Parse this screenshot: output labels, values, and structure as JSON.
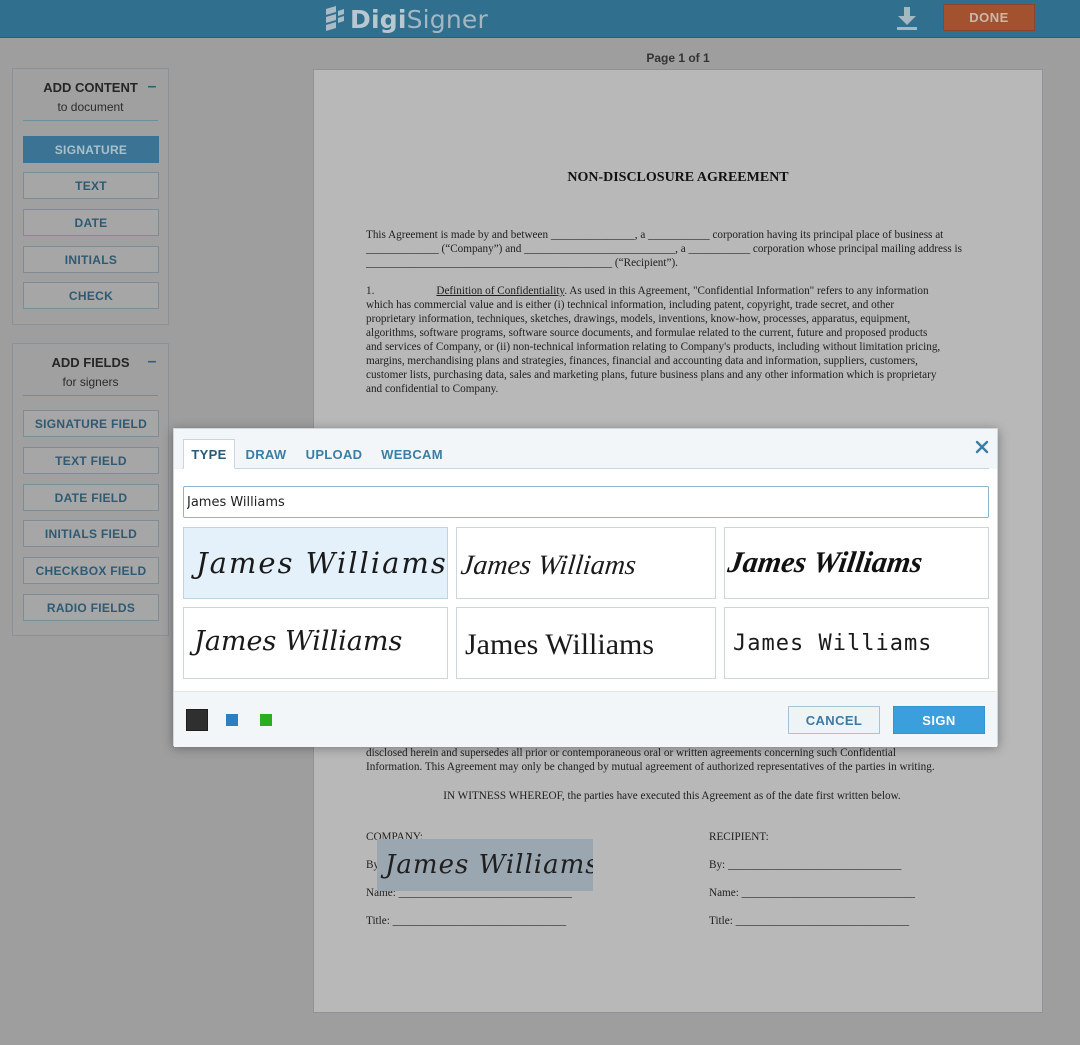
{
  "app": {
    "logo_text_bold": "Digi",
    "logo_text_light": "Signer",
    "download_icon": "download-icon",
    "done_label": "DONE"
  },
  "colors": {
    "topbar": "#316f8e",
    "done": "#a3522f",
    "active_button": "#3a7394",
    "sign_button": "#3a9fdc",
    "ink_black": "#2f2f2f",
    "ink_blue": "#2c7fc0",
    "ink_green": "#2aae1f"
  },
  "panels": {
    "content": {
      "title": "ADD CONTENT",
      "subtitle": "to document",
      "items": [
        {
          "label": "SIGNATURE"
        },
        {
          "label": "TEXT"
        },
        {
          "label": "DATE"
        },
        {
          "label": "INITIALS"
        },
        {
          "label": "CHECK"
        }
      ]
    },
    "fields": {
      "title": "ADD FIELDS",
      "subtitle": "for signers",
      "items": [
        {
          "label": "SIGNATURE FIELD"
        },
        {
          "label": "TEXT FIELD"
        },
        {
          "label": "DATE FIELD"
        },
        {
          "label": "INITIALS FIELD"
        },
        {
          "label": "CHECKBOX FIELD"
        },
        {
          "label": "RADIO FIELDS"
        }
      ]
    }
  },
  "document": {
    "page_label": "Page 1 of 1",
    "title": "NON-DISCLOSURE AGREEMENT",
    "intro": [
      "This Agreement is made by and between _______________, a ___________ corporation having its principal place of business at",
      "_____________ (“Company”) and ___________________________, a ___________ corporation whose principal mailing address is",
      "____________________________________________ (“Recipient”)."
    ],
    "section1_number": "1.",
    "section1_heading": "Definition of Confidentiality",
    "section1_lines": [
      ". As used in this Agreement, \"Confidential Information\" refers to any information",
      "which has commercial value and is either (i) technical information, including patent, copyright, trade secret, and other",
      "proprietary information, techniques, sketches, drawings, models, inventions, know-how, processes, apparatus, equipment,",
      "algorithms, software programs, software source documents, and formulae related to the current, future and proposed products",
      "and services of Company, or (ii) non-technical information relating to Company's products, including without limitation pricing,",
      "margins, merchandising plans and strategies, finances, financial and accounting data and information, suppliers, customers,",
      "customer lists, purchasing data, sales and marketing plans, future business plans and any other information which is proprietary",
      "and confidential to Company."
    ],
    "tail_lines": [
      "disclosed herein and supersedes all prior or contemporaneous oral or written agreements concerning such Confidential",
      "Information.  This Agreement may only be changed by mutual agreement of authorized representatives of the parties in writing."
    ],
    "witness": "IN WITNESS WHEREOF, the parties have executed this Agreement as of the date first written below.",
    "company": {
      "heading": "COMPANY:",
      "by": "By:",
      "name": "Name: _______________________________",
      "title": "Title: _______________________________"
    },
    "recipient": {
      "heading": "RECIPIENT:",
      "by": "By: _______________________________",
      "name": "Name: _______________________________",
      "title": "Title: _______________________________"
    },
    "placed_signature": "James Williams"
  },
  "dialog": {
    "tabs": [
      {
        "label": "TYPE"
      },
      {
        "label": "DRAW"
      },
      {
        "label": "UPLOAD"
      },
      {
        "label": "WEBCAM"
      }
    ],
    "active_tab": "TYPE",
    "close_icon": "close-icon",
    "input_value": "James Williams",
    "options": [
      {
        "text": "James Williams",
        "selected": true
      },
      {
        "text": "James Williams",
        "selected": false
      },
      {
        "text": "James Williams",
        "selected": false
      },
      {
        "text": "James Williams",
        "selected": false
      },
      {
        "text": "James Williams",
        "selected": false
      },
      {
        "text": "James Williams",
        "selected": false
      }
    ],
    "cancel_label": "CANCEL",
    "sign_label": "SIGN"
  }
}
